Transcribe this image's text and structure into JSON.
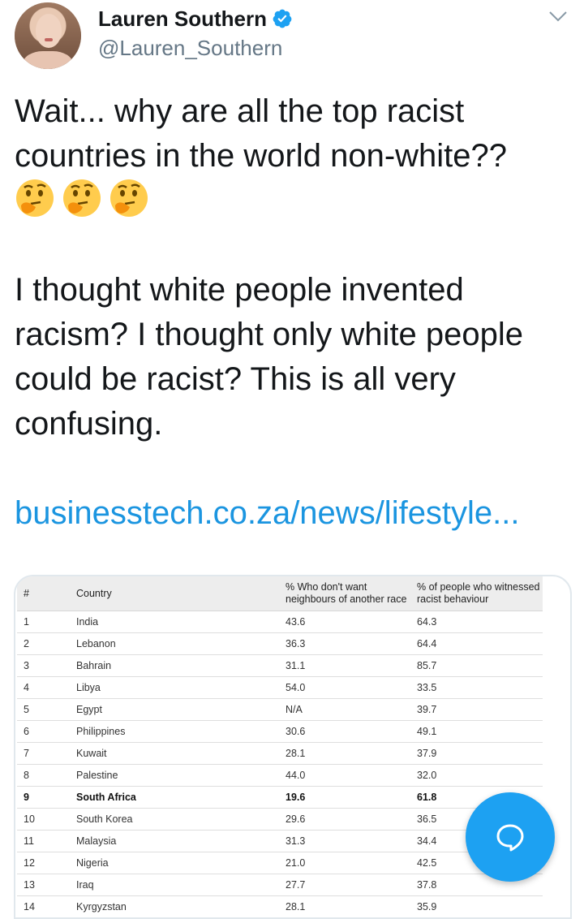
{
  "author": {
    "display_name": "Lauren Southern",
    "handle": "@Lauren_Southern"
  },
  "tweet": {
    "text_part1": "Wait... why are all the top racist\ncountries in the world non-white??",
    "emojis": [
      "thinking-face",
      "thinking-face",
      "thinking-face"
    ],
    "text_part2": "I thought white people invented\nracism? I thought only white people\ncould be racist? This is all very\nconfusing.",
    "link": "businesstech.co.za/news/lifestyle..."
  },
  "table": {
    "headers": [
      "#",
      "Country",
      "% Who don't want\nneighbours of another race",
      "% of people who witnessed\nracist behaviour"
    ],
    "rows": [
      [
        "1",
        "India",
        "43.6",
        "64.3"
      ],
      [
        "2",
        "Lebanon",
        "36.3",
        "64.4"
      ],
      [
        "3",
        "Bahrain",
        "31.1",
        "85.7"
      ],
      [
        "4",
        "Libya",
        "54.0",
        "33.5"
      ],
      [
        "5",
        "Egypt",
        "N/A",
        "39.7"
      ],
      [
        "6",
        "Philippines",
        "30.6",
        "49.1"
      ],
      [
        "7",
        "Kuwait",
        "28.1",
        "37.9"
      ],
      [
        "8",
        "Palestine",
        "44.0",
        "32.0"
      ],
      [
        "9",
        "South Africa",
        "19.6",
        "61.8"
      ],
      [
        "10",
        "South Korea",
        "29.6",
        "36.5"
      ],
      [
        "11",
        "Malaysia",
        "31.3",
        "34.4"
      ],
      [
        "12",
        "Nigeria",
        "21.0",
        "42.5"
      ],
      [
        "13",
        "Iraq",
        "27.7",
        "37.8"
      ],
      [
        "14",
        "Kyrgyzstan",
        "28.1",
        "35.9"
      ]
    ],
    "bold_row": "9"
  },
  "colors": {
    "link": "#1b95e0",
    "verified": "#1da1f2",
    "fab": "#1da1f2",
    "handle": "#657786"
  }
}
